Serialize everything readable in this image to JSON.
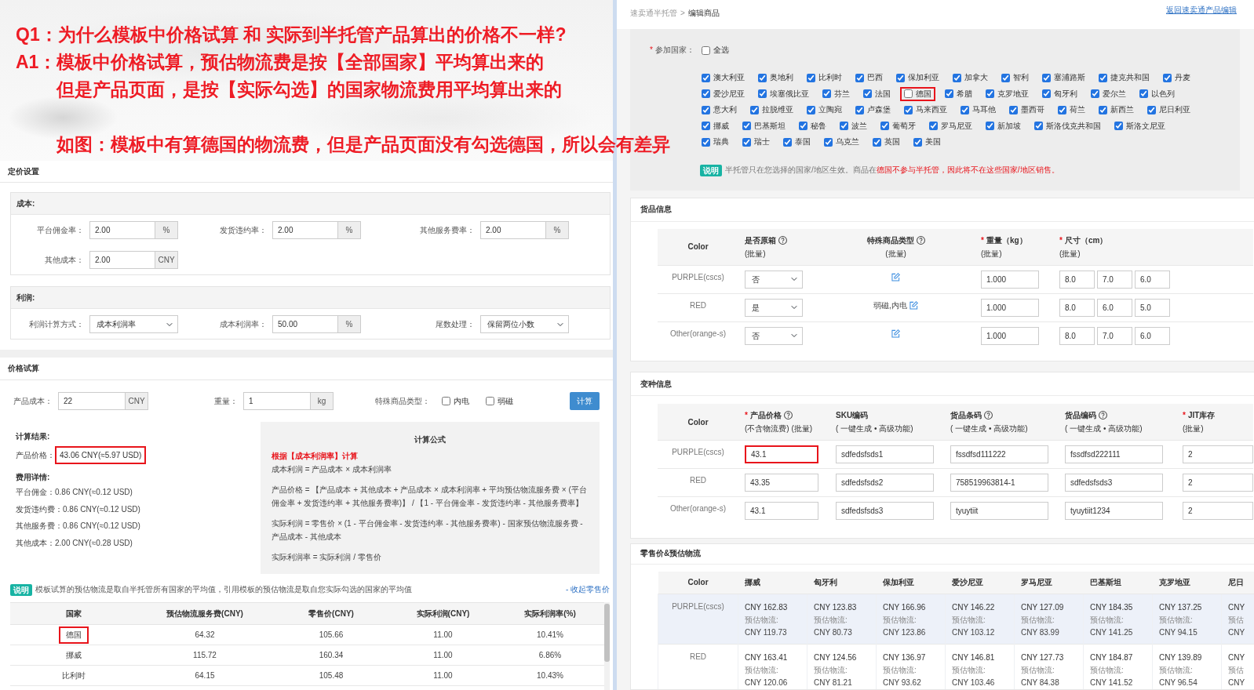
{
  "annotation": {
    "question": "Q1：为什么模板中价格试算 和 实际到半托管产品算出的价格不一样?",
    "answer": [
      "A1：模板中价格试算，预估物流费是按【全部国家】平均算出来的",
      "但是产品页面，是按【实际勾选】的国家物流费用平均算出来的"
    ],
    "example": "如图：模板中有算德国的物流费，但是产品页面没有勾选德国，所以会有差异"
  },
  "pricing_settings": {
    "title": "定价设置",
    "cost": {
      "title": "成本:",
      "fields": [
        {
          "kind": "input",
          "label": "平台佣金率：",
          "value": "2.00",
          "unit": "%"
        },
        {
          "kind": "input",
          "label": "发货违约率：",
          "value": "2.00",
          "unit": "%"
        },
        {
          "kind": "input",
          "label": "其他服务费率：",
          "value": "2.00",
          "unit": "%"
        },
        {
          "kind": "input",
          "label": "其他成本：",
          "value": "2.00",
          "unit": "CNY"
        }
      ]
    },
    "profit": {
      "title": "利润:",
      "fields": [
        {
          "kind": "select",
          "label": "利润计算方式：",
          "value": "成本利润率"
        },
        {
          "kind": "input",
          "label": "成本利润率：",
          "value": "50.00",
          "unit": "%"
        },
        {
          "kind": "select",
          "label": "尾数处理：",
          "value": "保留两位小数"
        }
      ]
    }
  },
  "price_trial": {
    "title": "价格试算",
    "inputs": [
      {
        "label": "产品成本：",
        "value": "22",
        "unit": "CNY"
      },
      {
        "label": "重量：",
        "value": "1",
        "unit": "kg"
      }
    ],
    "special_type": {
      "label": "特殊商品类型：",
      "options": [
        {
          "label": "内电",
          "checked": false
        },
        {
          "label": "弱磁",
          "checked": false
        }
      ]
    },
    "button": "计算",
    "result": {
      "title": "计算结果:",
      "price_label": "产品价格：",
      "price": "43.06 CNY(≈5.97 USD)",
      "highlighted": true,
      "fees_title": "费用详情:",
      "fees": [
        "平台佣金：0.86 CNY(≈0.12 USD)",
        "发货违约费：0.86 CNY(≈0.12 USD)",
        "其他服务费：0.86 CNY(≈0.12 USD)",
        "其他成本：2.00 CNY(≈0.28 USD)"
      ]
    },
    "formula": {
      "title": "计算公式",
      "basis": "根据【成本利润率】计算",
      "lines": [
        "成本利润 = 产品成本 × 成本利润率",
        "产品价格 = 【产品成本 + 其他成本 + 产品成本 × 成本利润率 + 平均预估物流服务费 × (平台佣金率 + 发货违约率 + 其他服务费率)】 / 【1 - 平台佣金率 - 发货违约率 - 其他服务费率】",
        "实际利润 = 零售价 × (1 - 平台佣金率 - 发货违约率 - 其他服务费率) - 国家预估物流服务费 - 产品成本 - 其他成本",
        "实际利润率 = 实际利润 / 零售价"
      ]
    },
    "note": {
      "badge": "说明",
      "text": "模板试算的预估物流是取自半托管所有国家的平均值，引用模板的预估物流是取自您实际勾选的国家的平均值",
      "toggle": "- 收起零售价"
    },
    "table": {
      "columns": [
        "国家",
        "预估物流服务费(CNY)",
        "零售价(CNY)",
        "实际利润(CNY)",
        "实际利润率(%)"
      ],
      "rows": [
        {
          "cells": [
            "德国",
            "64.32",
            "105.66",
            "11.00",
            "10.41%"
          ],
          "highlighted": true
        },
        {
          "cells": [
            "挪威",
            "115.72",
            "160.34",
            "11.00",
            "6.86%"
          ],
          "highlighted": false
        },
        {
          "cells": [
            "比利时",
            "64.15",
            "105.48",
            "11.00",
            "10.43%"
          ],
          "highlighted": false
        }
      ]
    }
  },
  "product_edit": {
    "breadcrumb": {
      "parent": "速卖通半托管",
      "separator": ">",
      "current": "编辑商品"
    },
    "back_link": "返回速卖通产品编辑",
    "countries": {
      "mark": "*",
      "label": "参加国家：",
      "select_all": {
        "label": "全选",
        "checked": false
      },
      "rows": [
        [
          {
            "label": "澳大利亚",
            "checked": true,
            "highlighted": false
          },
          {
            "label": "奥地利",
            "checked": true,
            "highlighted": false
          },
          {
            "label": "比利时",
            "checked": true,
            "highlighted": false
          },
          {
            "label": "巴西",
            "checked": true,
            "highlighted": false
          },
          {
            "label": "保加利亚",
            "checked": true,
            "highlighted": false
          },
          {
            "label": "加拿大",
            "checked": true,
            "highlighted": false
          },
          {
            "label": "智利",
            "checked": true,
            "highlighted": false
          },
          {
            "label": "塞浦路斯",
            "checked": true,
            "highlighted": false
          },
          {
            "label": "捷克共和国",
            "checked": true,
            "highlighted": false
          },
          {
            "label": "丹麦",
            "checked": true,
            "highlighted": false
          }
        ],
        [
          {
            "label": "爱沙尼亚",
            "checked": true,
            "highlighted": false
          },
          {
            "label": "埃塞俄比亚",
            "checked": true,
            "highlighted": false
          },
          {
            "label": "芬兰",
            "checked": true,
            "highlighted": false
          },
          {
            "label": "法国",
            "checked": true,
            "highlighted": false
          },
          {
            "label": "德国",
            "checked": false,
            "highlighted": true
          },
          {
            "label": "希腊",
            "checked": true,
            "highlighted": false
          },
          {
            "label": "克罗地亚",
            "checked": true,
            "highlighted": false
          },
          {
            "label": "匈牙利",
            "checked": true,
            "highlighted": false
          },
          {
            "label": "爱尔兰",
            "checked": true,
            "highlighted": false
          },
          {
            "label": "以色列",
            "checked": true,
            "highlighted": false
          }
        ],
        [
          {
            "label": "意大利",
            "checked": true,
            "highlighted": false
          },
          {
            "label": "拉脱维亚",
            "checked": true,
            "highlighted": false
          },
          {
            "label": "立陶宛",
            "checked": true,
            "highlighted": false
          },
          {
            "label": "卢森堡",
            "checked": true,
            "highlighted": false
          },
          {
            "label": "马来西亚",
            "checked": true,
            "highlighted": false
          },
          {
            "label": "马耳他",
            "checked": true,
            "highlighted": false
          },
          {
            "label": "墨西哥",
            "checked": true,
            "highlighted": false
          },
          {
            "label": "荷兰",
            "checked": true,
            "highlighted": false
          },
          {
            "label": "新西兰",
            "checked": true,
            "highlighted": false
          },
          {
            "label": "尼日利亚",
            "checked": true,
            "highlighted": false
          }
        ],
        [
          {
            "label": "挪威",
            "checked": true,
            "highlighted": false
          },
          {
            "label": "巴基斯坦",
            "checked": true,
            "highlighted": false
          },
          {
            "label": "秘鲁",
            "checked": true,
            "highlighted": false
          },
          {
            "label": "波兰",
            "checked": true,
            "highlighted": false
          },
          {
            "label": "葡萄牙",
            "checked": true,
            "highlighted": false
          },
          {
            "label": "罗马尼亚",
            "checked": true,
            "highlighted": false
          },
          {
            "label": "新加坡",
            "checked": true,
            "highlighted": false
          },
          {
            "label": "斯洛伐克共和国",
            "checked": true,
            "highlighted": false
          },
          {
            "label": "斯洛文尼亚",
            "checked": true,
            "highlighted": false
          }
        ],
        [
          {
            "label": "瑞典",
            "checked": true,
            "highlighted": false
          },
          {
            "label": "瑞士",
            "checked": true,
            "highlighted": false
          },
          {
            "label": "泰国",
            "checked": true,
            "highlighted": false
          },
          {
            "label": "乌克兰",
            "checked": true,
            "highlighted": false
          },
          {
            "label": "英国",
            "checked": true,
            "highlighted": false
          },
          {
            "label": "美国",
            "checked": true,
            "highlighted": false
          }
        ]
      ]
    },
    "notice": {
      "badge": "说明",
      "text": "半托管只在您选择的国家/地区生效。商品在",
      "warning": "德国不参与半托管，因此将不在这些国家/地区销售。"
    },
    "goods_info": {
      "title": "货品信息",
      "columns": [
        {
          "title": "Color"
        },
        {
          "title": "是否原箱",
          "help": true,
          "sub": {
            "prefix": "(",
            "links": [
              "批量"
            ],
            "suffix": ")"
          }
        },
        {
          "title": "特殊商品类型",
          "help": true,
          "sub": {
            "prefix": "(",
            "links": [
              "批量"
            ],
            "suffix": ")"
          }
        },
        {
          "mark": "*",
          "title": "重量（kg）",
          "sub": {
            "prefix": "(",
            "links": [
              "批量"
            ],
            "suffix": ")"
          }
        },
        {
          "mark": "*",
          "title": "尺寸（cm）",
          "sub": {
            "prefix": "(",
            "links": [
              "批量"
            ],
            "suffix": ")"
          }
        }
      ],
      "rows": [
        {
          "name": "PURPLE(cscs)",
          "original_box": "否",
          "weight": "1.000",
          "size": [
            "8.0",
            "7.0",
            "6.0"
          ]
        },
        {
          "name": "RED",
          "original_box": "是",
          "special_type": "弱磁,内电",
          "weight": "1.000",
          "size": [
            "8.0",
            "6.0",
            "5.0"
          ]
        },
        {
          "name": "Other(orange-s)",
          "original_box": "否",
          "weight": "1.000",
          "size": [
            "8.0",
            "7.0",
            "6.0"
          ]
        }
      ]
    },
    "variant_info": {
      "title": "变种信息",
      "columns": [
        {
          "title": "Color"
        },
        {
          "mark": "*",
          "title": "产品价格",
          "help": true,
          "sub": {
            "prefix": "(不含物流费) (",
            "links": [
              "批量"
            ],
            "suffix": ")"
          }
        },
        {
          "title": "SKU编码",
          "sub": {
            "prefix": "( ",
            "links": [
              "一键生成",
              "高级功能"
            ],
            "separator": " • ",
            "suffix": ")"
          }
        },
        {
          "title": "货品条码",
          "help": true,
          "sub": {
            "prefix": "( ",
            "links": [
              "一键生成",
              "高级功能"
            ],
            "separator": " • ",
            "suffix": ")"
          }
        },
        {
          "title": "货品编码",
          "help": true,
          "sub": {
            "prefix": "( ",
            "links": [
              "一键生成",
              "高级功能"
            ],
            "separator": " • ",
            "suffix": ")"
          }
        },
        {
          "mark": "*",
          "title": "JIT库存",
          "sub": {
            "prefix": "(",
            "links": [
              "批量"
            ],
            "suffix": ")"
          }
        }
      ],
      "rows": [
        {
          "name": "PURPLE(cscs)",
          "price_highlighted": true,
          "values": [
            "43.1",
            "sdfedsfsds1",
            "fssdfsd111222",
            "fssdfsd222111",
            "2"
          ]
        },
        {
          "name": "RED",
          "price_highlighted": false,
          "values": [
            "43.35",
            "sdfedsfsds2",
            "758519963814-1",
            "sdfedsfsds3",
            "2"
          ]
        },
        {
          "name": "Other(orange-s)",
          "price_highlighted": false,
          "values": [
            "43.1",
            "sdfedsfsds3",
            "tyuytiit",
            "tyuytiit1234",
            "2"
          ]
        }
      ]
    },
    "retail": {
      "title": "零售价&预估物流",
      "columns": [
        "Color",
        "挪威",
        "匈牙利",
        "保加利亚",
        "爱沙尼亚",
        "罗马尼亚",
        "巴基斯坦",
        "克罗地亚",
        "尼日"
      ],
      "rows": [
        {
          "highlighted": true,
          "cells": [
            {
              "kind": "name",
              "text": "PURPLE(cscs)"
            },
            {
              "kind": "price",
              "price": "CNY 162.83",
              "label": "预估物流:",
              "logistics": "CNY 119.73"
            },
            {
              "kind": "price",
              "price": "CNY 123.83",
              "label": "预估物流:",
              "logistics": "CNY 80.73"
            },
            {
              "kind": "price",
              "price": "CNY 166.96",
              "label": "预估物流:",
              "logistics": "CNY 123.86"
            },
            {
              "kind": "price",
              "price": "CNY 146.22",
              "label": "预估物流:",
              "logistics": "CNY 103.12"
            },
            {
              "kind": "price",
              "price": "CNY 127.09",
              "label": "预估物流:",
              "logistics": "CNY 83.99"
            },
            {
              "kind": "price",
              "price": "CNY 184.35",
              "label": "预估物流:",
              "logistics": "CNY 141.25"
            },
            {
              "kind": "price",
              "price": "CNY 137.25",
              "label": "预估物流:",
              "logistics": "CNY 94.15"
            },
            {
              "kind": "price",
              "price": "CNY",
              "label": "预估",
              "logistics": "CNY"
            }
          ]
        },
        {
          "highlighted": false,
          "cells": [
            {
              "kind": "name",
              "text": "RED"
            },
            {
              "kind": "price",
              "price": "CNY 163.41",
              "label": "预估物流:",
              "logistics": "CNY 120.06"
            },
            {
              "kind": "price",
              "price": "CNY 124.56",
              "label": "预估物流:",
              "logistics": "CNY 81.21"
            },
            {
              "kind": "price",
              "price": "CNY 136.97",
              "label": "预估物流:",
              "logistics": "CNY 93.62"
            },
            {
              "kind": "price",
              "price": "CNY 146.81",
              "label": "预估物流:",
              "logistics": "CNY 103.46"
            },
            {
              "kind": "price",
              "price": "CNY 127.73",
              "label": "预估物流:",
              "logistics": "CNY 84.38"
            },
            {
              "kind": "price",
              "price": "CNY 184.87",
              "label": "预估物流:",
              "logistics": "CNY 141.52"
            },
            {
              "kind": "price",
              "price": "CNY 139.89",
              "label": "预估物流:",
              "logistics": "CNY 96.54"
            },
            {
              "kind": "price",
              "price": "CNY",
              "label": "预估",
              "logistics": "CNY"
            }
          ]
        }
      ]
    }
  }
}
